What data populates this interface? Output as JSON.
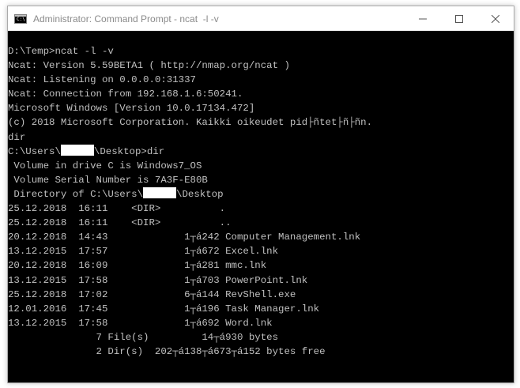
{
  "window": {
    "title": "Administrator: Command Prompt - ncat  -l -v",
    "app_icon_glyph": "C:\\",
    "icons": {
      "app": "command-prompt-icon",
      "minimize": "minimize-icon",
      "maximize": "maximize-icon",
      "close": "close-icon"
    }
  },
  "console": {
    "lines": [
      "D:\\Temp>ncat -l -v",
      "Ncat: Version 5.59BETA1 ( http://nmap.org/ncat )",
      "Ncat: Listening on 0.0.0.0:31337",
      "Ncat: Connection from 192.168.1.6:50241.",
      "Microsoft Windows [Version 10.0.17134.472]",
      "(c) 2018 Microsoft Corporation. Kaikki oikeudet pid├ñtet├ñ├ñn.",
      "dir"
    ],
    "prompt_prefix": "C:\\Users\\",
    "prompt_suffix": "\\Desktop>dir",
    "volume_lines": [
      " Volume in drive C is Windows7_OS",
      " Volume Serial Number is 7A3F-E80B"
    ],
    "directory_prefix": " Directory of C:\\Users\\",
    "directory_suffix": "\\Desktop",
    "listing": [
      "25.12.2018  16:11    <DIR>          .",
      "25.12.2018  16:11    <DIR>          ..",
      "20.12.2018  14:43             1┬á242 Computer Management.lnk",
      "13.12.2015  17:57             1┬á672 Excel.lnk",
      "20.12.2018  16:09             1┬á281 mmc.lnk",
      "13.12.2015  17:58             1┬á703 PowerPoint.lnk",
      "25.12.2018  17:02             6┬á144 RevShell.exe",
      "12.01.2016  17:45             1┬á196 Task Manager.lnk",
      "13.12.2015  17:58             1┬á692 Word.lnk"
    ],
    "summary": [
      "               7 File(s)         14┬á930 bytes",
      "               2 Dir(s)  202┬á138┬á673┬á152 bytes free"
    ]
  }
}
